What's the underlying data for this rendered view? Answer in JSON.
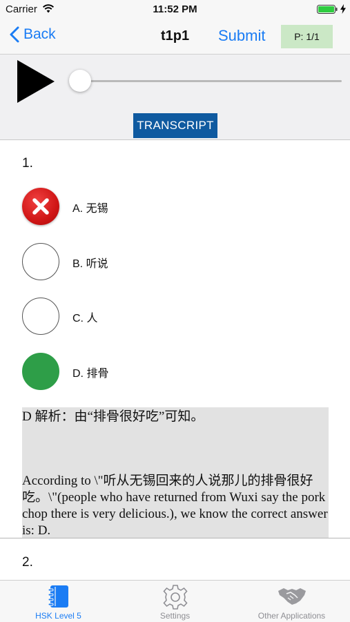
{
  "status_bar": {
    "carrier": "Carrier",
    "time": "11:52 PM"
  },
  "nav": {
    "back_label": "Back",
    "title": "t1p1",
    "submit_label": "Submit",
    "page_badge": "P: 1/1"
  },
  "audio": {
    "progress_fraction": 0.0,
    "transcript_label": "TRANSCRIPT"
  },
  "question1": {
    "number": "1.",
    "options": [
      {
        "label": "A. 无锡",
        "state": "wrong"
      },
      {
        "label": "B. 听说",
        "state": "none"
      },
      {
        "label": "C. 人",
        "state": "none"
      },
      {
        "label": "D. 排骨",
        "state": "correct"
      }
    ],
    "explanation": {
      "line1": "D 解析：由“排骨很好吃”可知。",
      "line2": "According to \\\"听从无锡回来的人说那儿的排骨很好吃。\\\"(people who have returned from Wuxi say the pork chop there is very delicious.), we know the correct answer is: D."
    }
  },
  "question2": {
    "number": "2."
  },
  "tab_bar": {
    "tabs": [
      {
        "label": "HSK Level 5",
        "icon": "notebook-icon",
        "active": true
      },
      {
        "label": "Settings",
        "icon": "gear-icon",
        "active": false
      },
      {
        "label": "Other Applications",
        "icon": "handshake-icon",
        "active": false
      }
    ]
  },
  "colors": {
    "accent": "#1a7cf4",
    "transcript_bg": "#0f5aa0",
    "correct": "#2e9e48",
    "wrong": "#d01616",
    "badge_bg": "#cbe8c6",
    "explanation_bg": "#e2e2e2"
  }
}
